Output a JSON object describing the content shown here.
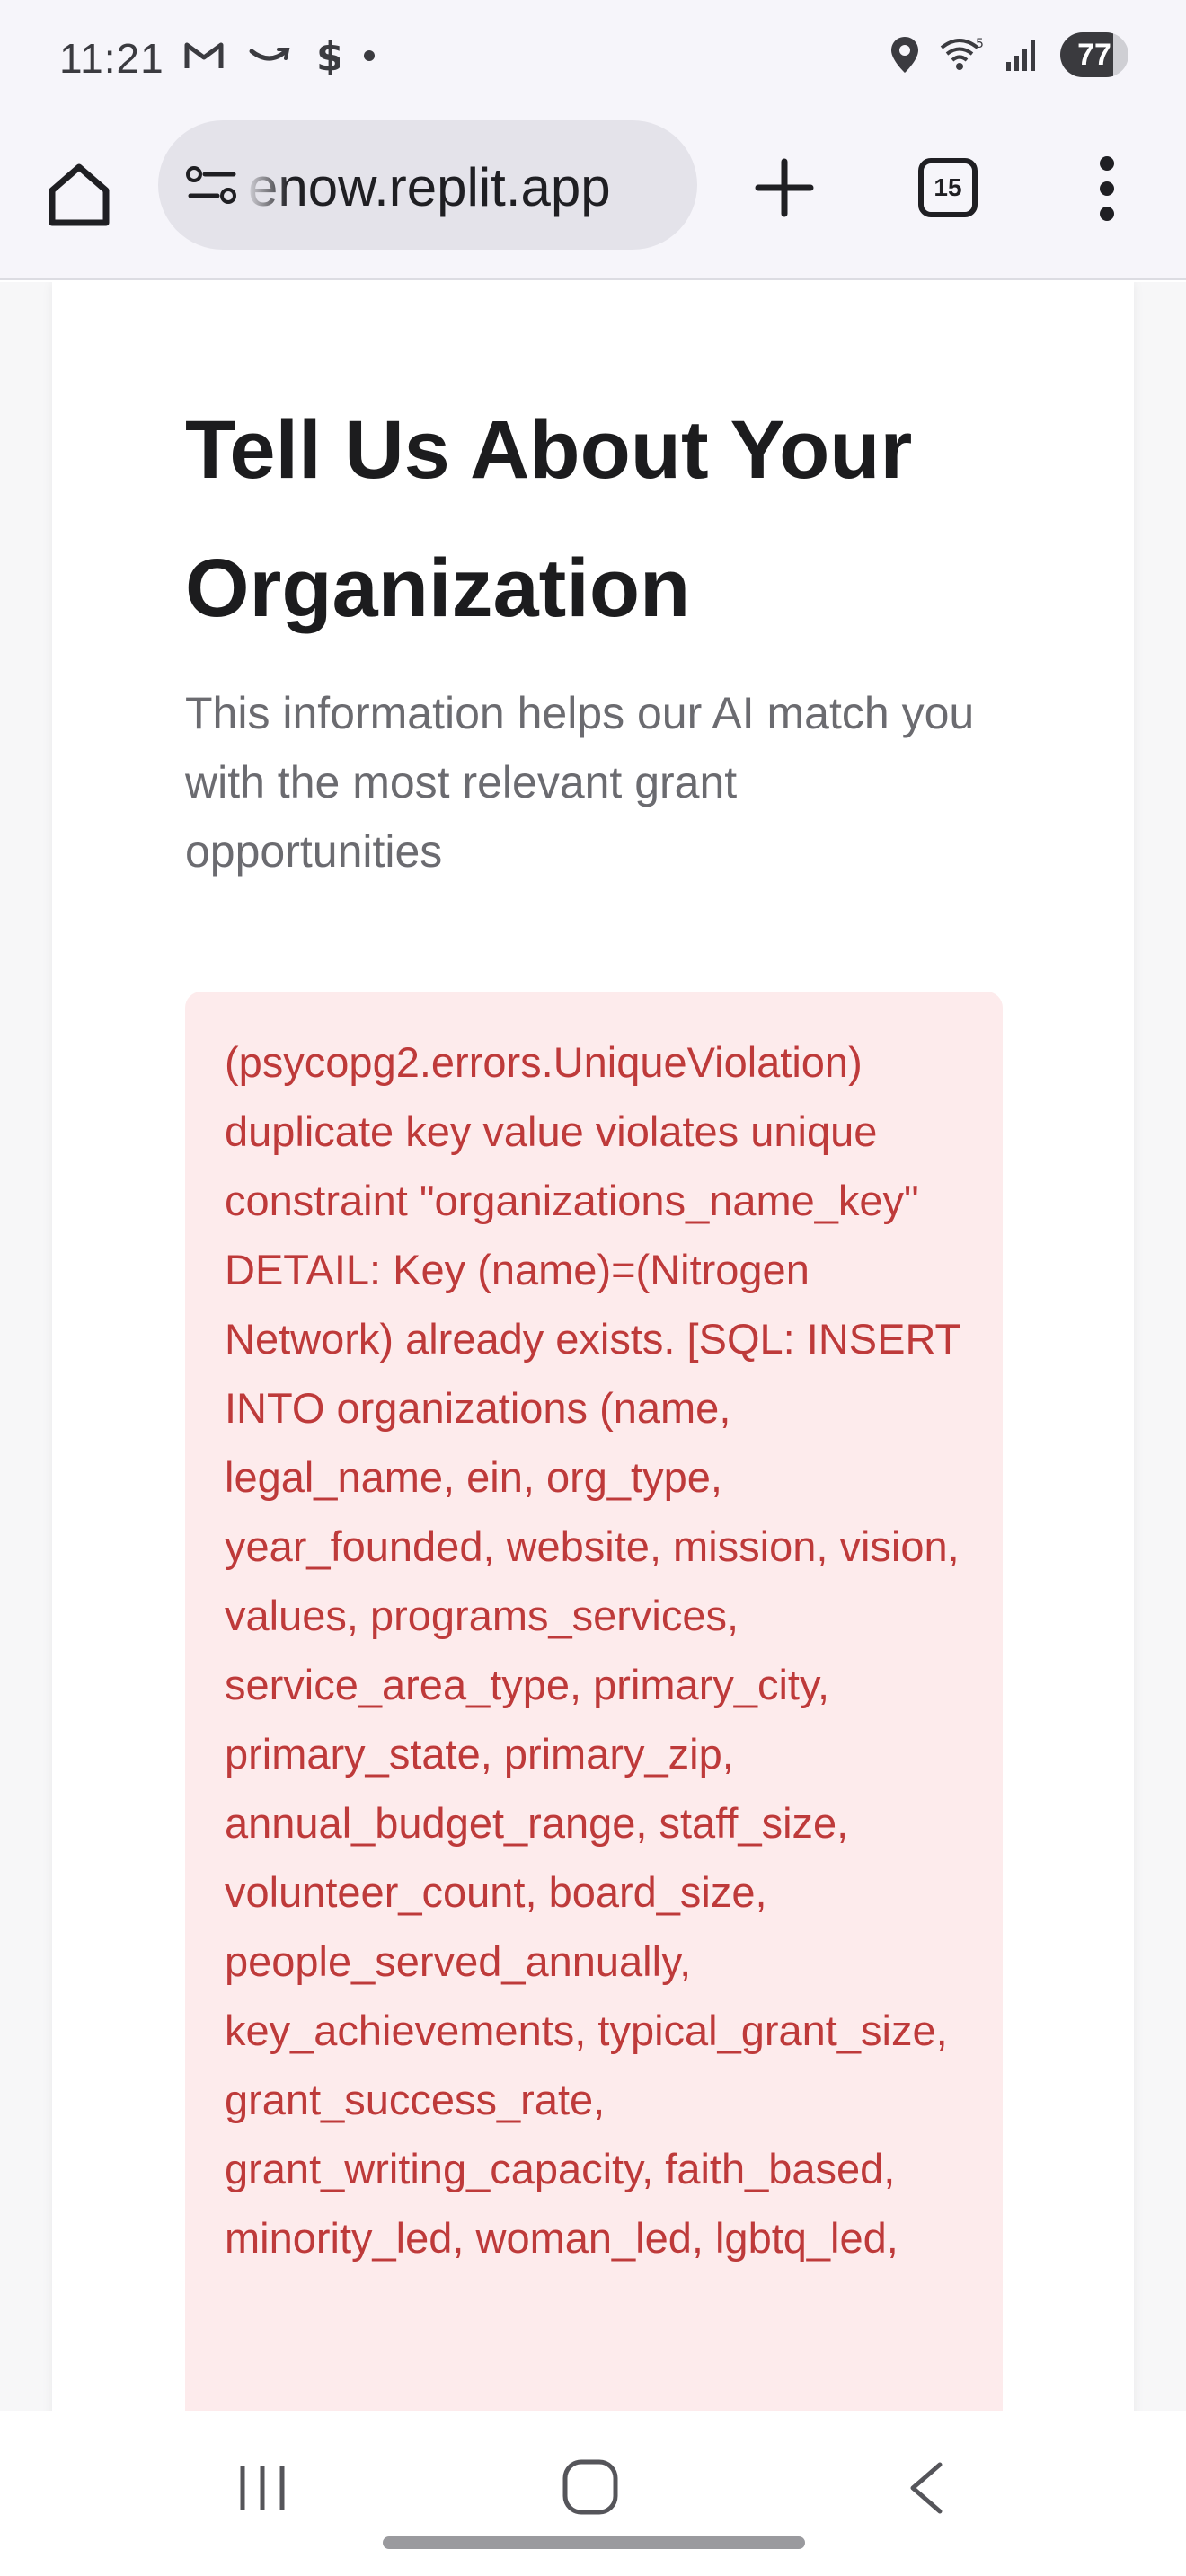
{
  "status_bar": {
    "time": "11:21",
    "battery": "77",
    "left_icons": [
      "gmail-icon",
      "amazon-icon",
      "dollar-icon",
      "dot-icon"
    ],
    "right_icons": [
      "location-icon",
      "wifi-icon",
      "signal-icon",
      "battery-icon"
    ]
  },
  "browser": {
    "url": "enow.replit.app",
    "tab_count": "15"
  },
  "page": {
    "title": "Tell Us About Your Organization",
    "subtitle": "This information helps our AI match you with the most relevant grant opportunities",
    "error_message": "(psycopg2.errors.UniqueViolation) duplicate key value violates unique constraint \"organizations_name_key\" DETAIL: Key (name)=(Nitrogen Network) already exists. [SQL: INSERT INTO organizations (name, legal_name, ein, org_type, year_founded, website, mission, vision, values, programs_services, service_area_type, primary_city, primary_state, primary_zip, annual_budget_range, staff_size, volunteer_count, board_size, people_served_annually, key_achievements, typical_grant_size, grant_success_rate, grant_writing_capacity, faith_based, minority_led, woman_led, lgbtq_led,"
  },
  "colors": {
    "error_bg": "#fdebec",
    "error_text": "#be3a3a",
    "title": "#1c1c1e",
    "subtitle": "#6b6b70"
  }
}
